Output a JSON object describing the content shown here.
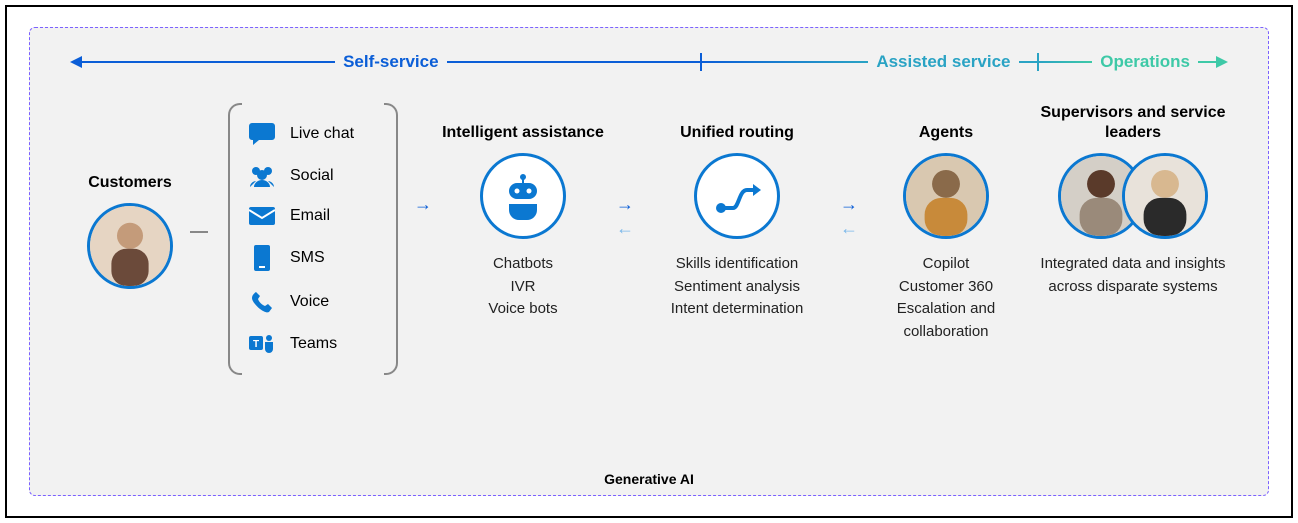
{
  "banner": {
    "self_service": "Self-service",
    "assisted_service": "Assisted service",
    "operations": "Operations"
  },
  "footer": "Generative AI",
  "customers": {
    "title": "Customers"
  },
  "channels": [
    {
      "icon": "chat-icon",
      "label": "Live chat"
    },
    {
      "icon": "social-icon",
      "label": "Social"
    },
    {
      "icon": "email-icon",
      "label": "Email"
    },
    {
      "icon": "sms-icon",
      "label": "SMS"
    },
    {
      "icon": "voice-icon",
      "label": "Voice"
    },
    {
      "icon": "teams-icon",
      "label": "Teams"
    }
  ],
  "intelligent": {
    "title": "Intelligent assistance",
    "items": [
      "Chatbots",
      "IVR",
      "Voice bots"
    ]
  },
  "routing": {
    "title": "Unified routing",
    "items": [
      "Skills identification",
      "Sentiment analysis",
      "Intent determination"
    ]
  },
  "agents": {
    "title": "Agents",
    "items": [
      "Copilot",
      "Customer 360",
      "Escalation and collaboration"
    ]
  },
  "supervisors": {
    "title": "Supervisors and service leaders",
    "desc": "Integrated data and insights across disparate systems"
  }
}
